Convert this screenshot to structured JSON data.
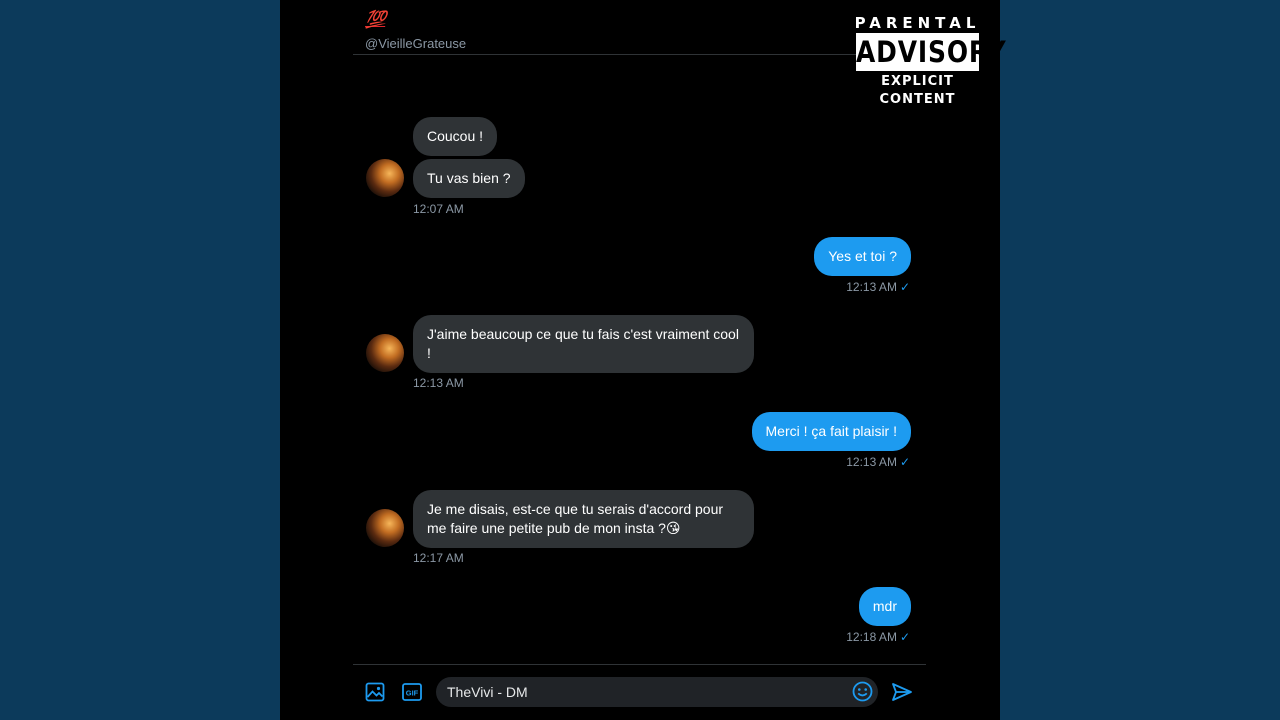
{
  "header": {
    "emoji": "💯",
    "handle": "@VieilleGrateuse"
  },
  "advisory": {
    "top": "PARENTAL",
    "middle": "ADVISORY",
    "bottom": "EXPLICIT CONTENT"
  },
  "messages": [
    {
      "text": "Coucou !"
    },
    {
      "text": "Tu vas bien ?"
    },
    {
      "time": "12:07 AM"
    },
    {
      "text": "Yes et toi ?",
      "time": "12:13 AM"
    },
    {
      "text": "J'aime beaucoup ce que tu fais c'est vraiment cool !",
      "time": "12:13 AM"
    },
    {
      "text": "Merci ! ça fait plaisir !",
      "time": "12:13 AM"
    },
    {
      "text": "Je me disais, est-ce que tu serais d'accord pour me faire une petite pub de mon insta ?😘",
      "time": "12:17 AM"
    },
    {
      "text": "mdr",
      "time": "12:18 AM"
    }
  ],
  "read_check": "✓",
  "composer": {
    "value": "TheVivi - DM",
    "gif_label": "GIF"
  },
  "colors": {
    "background": "#0c3a5b",
    "panel": "#000000",
    "incoming_bubble": "#2f3336",
    "outgoing_bubble": "#1d9bf0",
    "accent": "#1d9bf0"
  },
  "icons": [
    "image-icon",
    "gif-icon",
    "emoji-icon",
    "send-icon"
  ]
}
